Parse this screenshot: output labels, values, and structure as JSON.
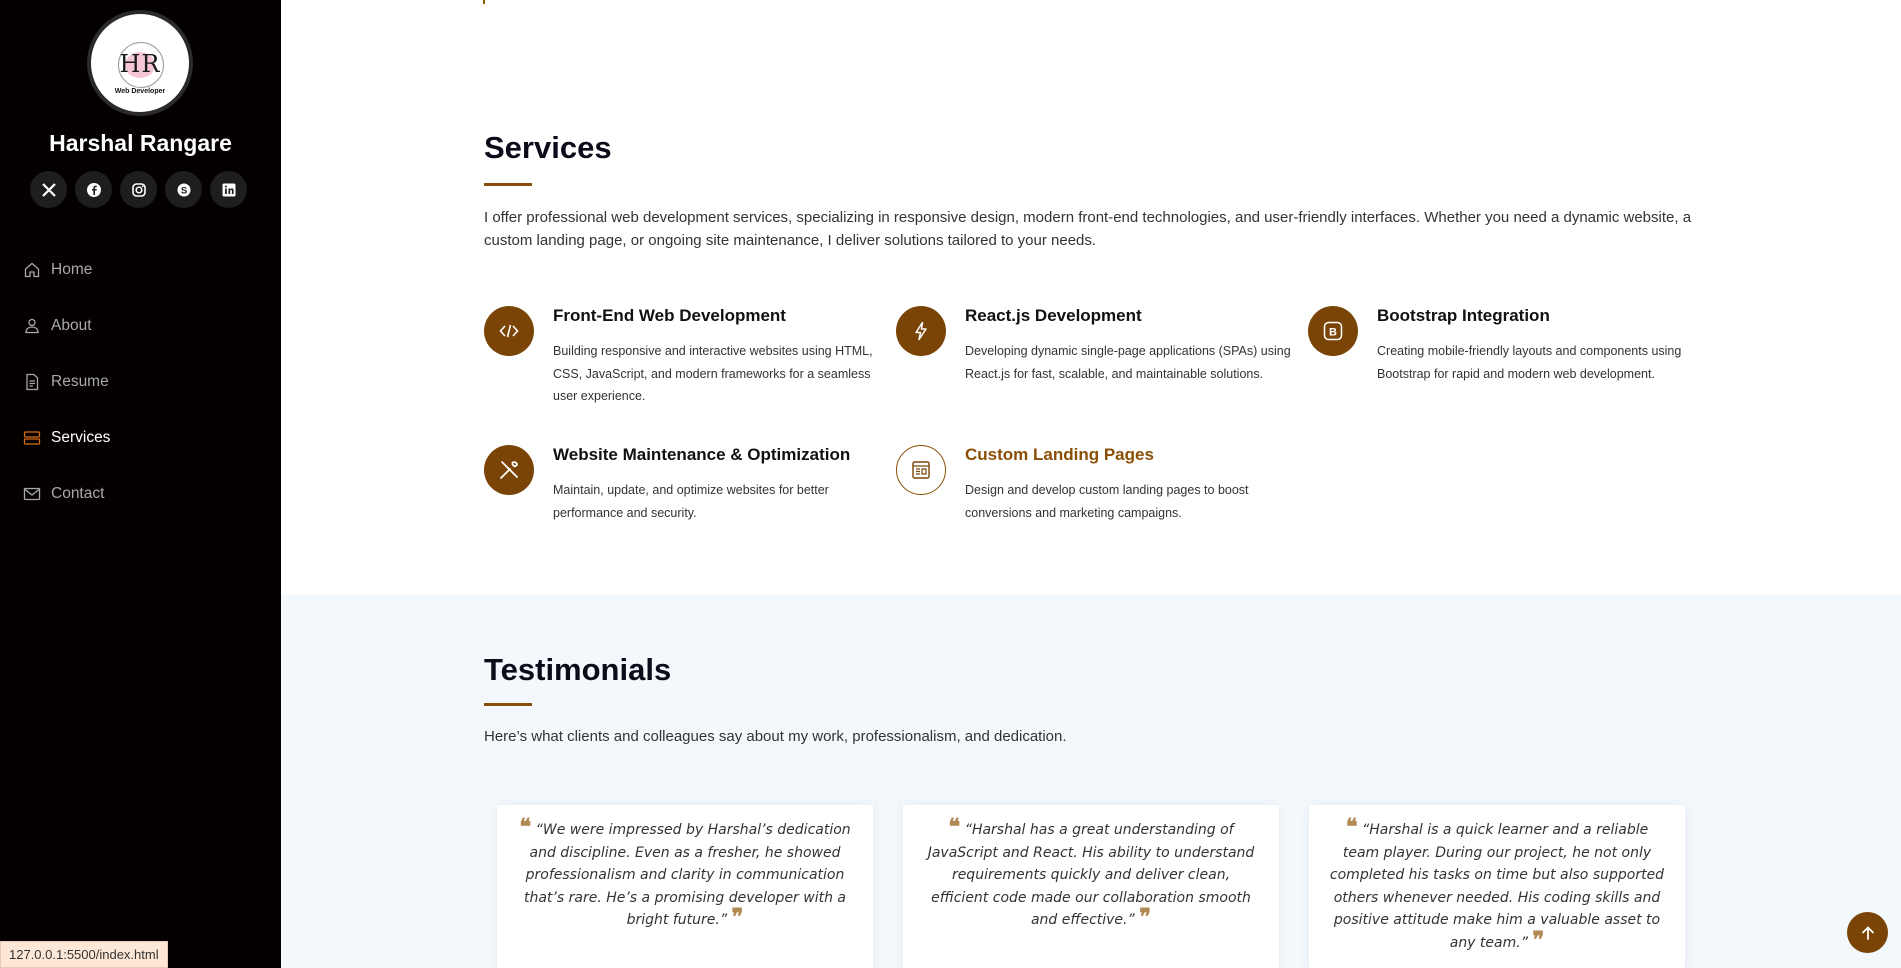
{
  "sidebar": {
    "avatar": {
      "monogram": "HR",
      "subtitle": "Web Developer"
    },
    "name": "Harshal Rangare",
    "socials": [
      {
        "icon": "x-twitter-icon"
      },
      {
        "icon": "facebook-icon"
      },
      {
        "icon": "instagram-icon"
      },
      {
        "icon": "skype-icon"
      },
      {
        "icon": "linkedin-icon"
      }
    ],
    "nav": [
      {
        "label": "Home",
        "icon": "house-icon"
      },
      {
        "label": "About",
        "icon": "person-icon"
      },
      {
        "label": "Resume",
        "icon": "file-text-icon"
      },
      {
        "label": "Services",
        "icon": "hdd-stack-icon",
        "active": true
      },
      {
        "label": "Contact",
        "icon": "envelope-icon"
      }
    ]
  },
  "services": {
    "title": "Services",
    "lead": "I offer professional web development services, specializing in responsive design, modern front-end technologies, and user-friendly interfaces. Whether you need a dynamic website, a custom landing page, or ongoing site maintenance, I deliver solutions tailored to your needs.",
    "items": [
      {
        "title": "Front-End Web Development",
        "desc": "Building responsive and interactive websites using HTML, CSS, JavaScript, and modern frameworks for a seamless user experience.",
        "icon": "code-slash-icon"
      },
      {
        "title": "React.js Development",
        "desc": "Developing dynamic single-page applications (SPAs) using React.js for fast, scalable, and maintainable solutions.",
        "icon": "lightning-icon"
      },
      {
        "title": "Bootstrap Integration",
        "desc": "Creating mobile-friendly layouts and components using Bootstrap for rapid and modern web development.",
        "icon": "bootstrap-icon"
      },
      {
        "title": "Website Maintenance & Optimization",
        "desc": "Maintain, update, and optimize websites for better performance and security.",
        "icon": "tools-icon"
      },
      {
        "title": "Custom Landing Pages",
        "desc": "Design and develop custom landing pages to boost conversions and marketing campaigns.",
        "icon": "layout-icon",
        "highlighted": true
      }
    ]
  },
  "testimonials": {
    "title": "Testimonials",
    "lead": "Here’s what clients and colleagues say about my work, professionalism, and dedication.",
    "items": [
      {
        "text": "“We were impressed by Harshal’s dedication and discipline. Even as a fresher, he showed professionalism and clarity in communication that’s rare. He’s a promising developer with a bright future.”"
      },
      {
        "text": "“Harshal has a great understanding of JavaScript and React. His ability to understand requirements quickly and deliver clean, efficient code made our collaboration smooth and effective.”"
      },
      {
        "text": "“Harshal is a quick learner and a reliable team player. During our project, he not only completed his tasks on time but also supported others whenever needed. His coding skills and positive attitude make him a valuable asset to any team.”"
      }
    ]
  },
  "status_url": "127.0.0.1:5500/index.html",
  "colors": {
    "accent": "#7a4406",
    "sidebar_bg": "#040000",
    "testimonials_bg": "#f3f8fc"
  }
}
